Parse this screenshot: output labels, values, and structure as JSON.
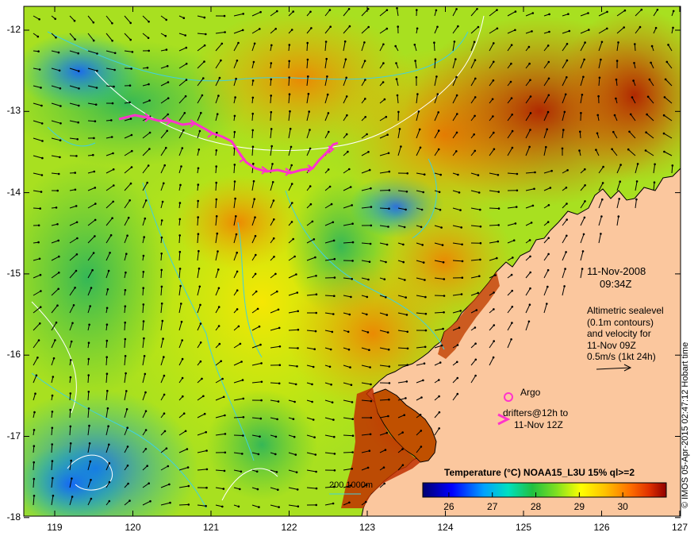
{
  "map": {
    "x_ticks": [
      "119",
      "120",
      "121",
      "122",
      "123",
      "124",
      "125",
      "126",
      "127"
    ],
    "y_ticks": [
      "-12",
      "-13",
      "-14",
      "-15",
      "-16",
      "-17",
      "-18"
    ],
    "land_color": "#FBC79E",
    "date": "11-Nov-2008",
    "time": "09:34Z",
    "altimetry_lines": [
      "Altimetric sealevel",
      "(0.1m contours)",
      "and velocity for",
      "11-Nov 09Z",
      "0.5m/s (1kt 24h)"
    ],
    "argo_label": "Argo",
    "drifter_line1": "drifters@12h to",
    "drifter_line2": "11-Nov 12Z",
    "colorbar_title": "Temperature (°C) NOAA15_L3U 15% ql>=2",
    "colorbar_ticks": [
      "26",
      "27",
      "28",
      "29",
      "30"
    ],
    "colorbar_range": [
      25.4,
      31.0
    ],
    "depth_legend": "200  1000m",
    "credit": "© IMOS 05-Apr-2015 02:47:12 Hobart time",
    "icons": [
      "argo-float-icon",
      "drifter-arrow-icon",
      "velocity-scale-arrow-icon"
    ],
    "drifter_color": "#FF33CC"
  }
}
